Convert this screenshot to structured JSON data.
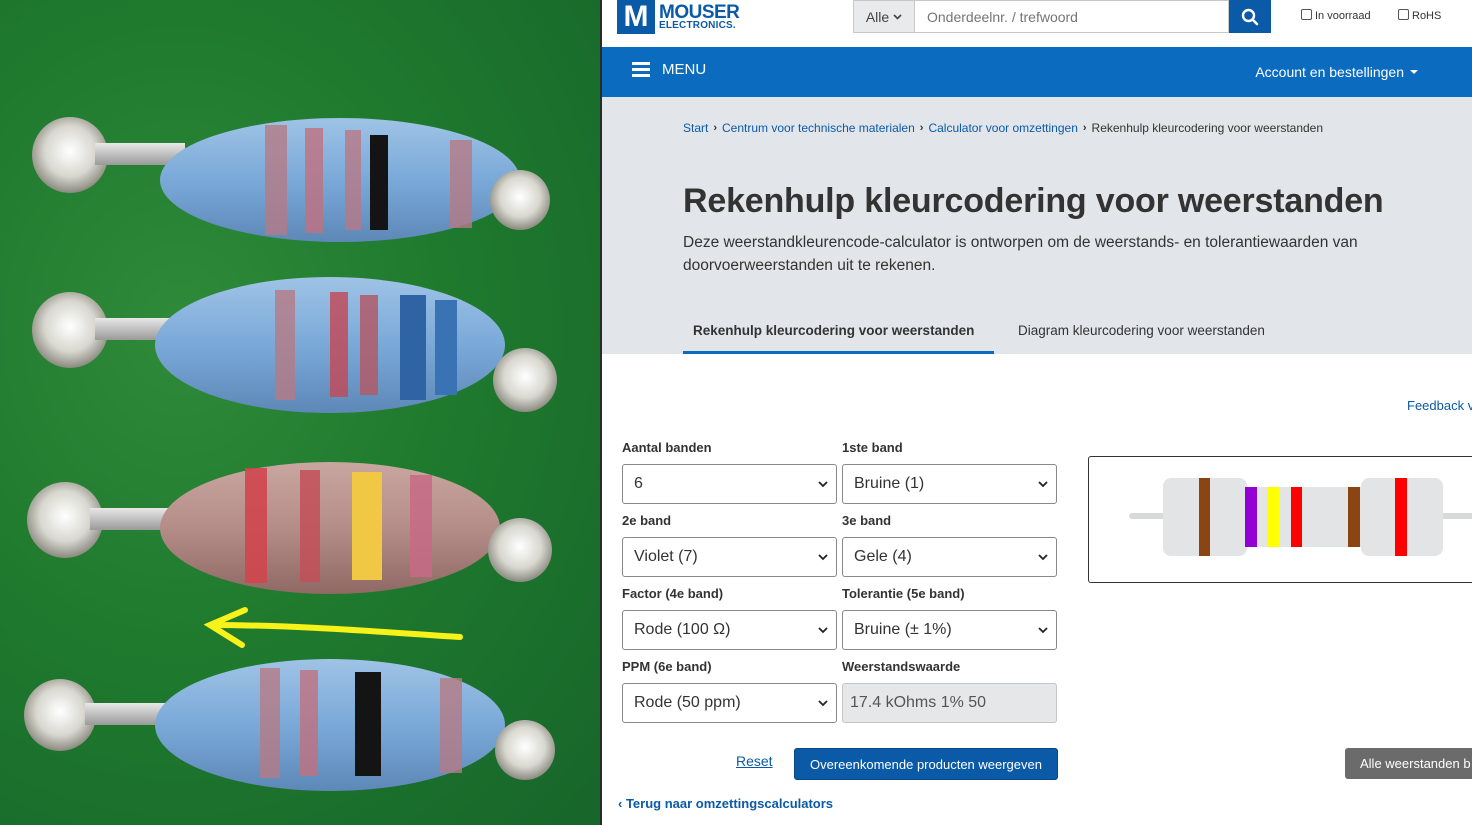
{
  "header": {
    "logo_main": "MOUSER",
    "logo_sub": "ELECTRONICS.",
    "search_scope": "Alle",
    "search_placeholder": "Onderdeelnr. / trefwoord",
    "check_in_stock": "In voorraad",
    "check_rohs": "RoHS"
  },
  "nav": {
    "menu_label": "MENU",
    "account_label": "Account en bestellingen"
  },
  "breadcrumbs": [
    "Start",
    "Centrum voor technische materialen",
    "Calculator voor omzettingen",
    "Rekenhulp kleurcodering voor weerstanden"
  ],
  "page": {
    "title": "Rekenhulp kleurcodering voor weerstanden",
    "intro": "Deze weerstandkleurencode-calculator is ontworpen om de weerstands- en tolerantiewaarden van doorvoerweerstanden uit te rekenen.",
    "tab_active": "Rekenhulp kleurcodering voor weerstanden",
    "tab_other": "Diagram kleurcodering voor weerstanden",
    "feedback": "Feedback v"
  },
  "form": {
    "bands_label": "Aantal banden",
    "bands_value": "6",
    "band1_label": "1ste band",
    "band1_value": "Bruine (1)",
    "band2_label": "2e band",
    "band2_value": "Violet (7)",
    "band3_label": "3e band",
    "band3_value": "Gele (4)",
    "band4_label": "Factor (4e band)",
    "band4_value": "Rode (100 Ω)",
    "band5_label": "Tolerantie (5e band)",
    "band5_value": "Bruine (± 1%)",
    "band6_label": "PPM (6e band)",
    "band6_value": "Rode (50 ppm)",
    "result_label": "Weerstandswaarde",
    "result_value": "17.4 kOhms 1% 50"
  },
  "diagram_colors": {
    "body": "#e3e4e6",
    "lead": "#d8d9db",
    "band1": "#8b4513",
    "band2": "#9400d3",
    "band3": "#ffff00",
    "band4": "#ff0000",
    "band5": "#8b4513",
    "band6": "#ff0000"
  },
  "actions": {
    "reset": "Reset",
    "show_products": "Overeenkomende producten weergeven",
    "all_resistors": "Alle weerstanden b",
    "back": "Terug naar omzettingscalculators"
  },
  "colors": {
    "brand_blue": "#0b6bbf",
    "link_blue": "#0b5aa8"
  }
}
